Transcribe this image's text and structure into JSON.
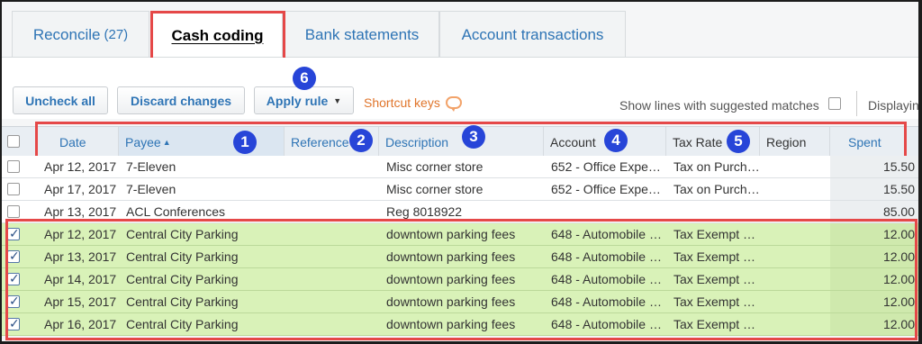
{
  "tabs": [
    {
      "label": "Reconcile",
      "count": "(27)"
    },
    {
      "label": "Cash coding"
    },
    {
      "label": "Bank statements"
    },
    {
      "label": "Account transactions"
    }
  ],
  "toolbar": {
    "uncheck_all": "Uncheck all",
    "discard_changes": "Discard changes",
    "apply_rule": "Apply rule",
    "shortcut_keys": "Shortcut keys",
    "suggested_label": "Show lines with suggested matches",
    "displaying": "Displaying"
  },
  "badges": [
    "1",
    "2",
    "3",
    "4",
    "5",
    "6"
  ],
  "columns": {
    "date": "Date",
    "payee": "Payee",
    "reference": "Reference",
    "description": "Description",
    "account": "Account",
    "tax_rate": "Tax Rate",
    "region": "Region",
    "spent": "Spent"
  },
  "rows": [
    {
      "date": "Apr 12, 2017",
      "payee": "7-Eleven",
      "reference": "",
      "description": "Misc corner store",
      "account": "652 - Office Expe…",
      "tax_rate": "Tax on Purch…",
      "region": "",
      "spent": "15.50"
    },
    {
      "date": "Apr 17, 2017",
      "payee": "7-Eleven",
      "reference": "",
      "description": "Misc corner store",
      "account": "652 - Office Expe…",
      "tax_rate": "Tax on Purch…",
      "region": "",
      "spent": "15.50"
    },
    {
      "date": "Apr 13, 2017",
      "payee": "ACL Conferences",
      "reference": "",
      "description": "Reg 8018922",
      "account": "",
      "tax_rate": "",
      "region": "",
      "spent": "85.00"
    },
    {
      "date": "Apr 12, 2017",
      "payee": "Central City Parking",
      "reference": "",
      "description": "downtown parking fees",
      "account": "648 - Automobile …",
      "tax_rate": "Tax Exempt …",
      "region": "",
      "spent": "12.00"
    },
    {
      "date": "Apr 13, 2017",
      "payee": "Central City Parking",
      "reference": "",
      "description": "downtown parking fees",
      "account": "648 - Automobile …",
      "tax_rate": "Tax Exempt …",
      "region": "",
      "spent": "12.00"
    },
    {
      "date": "Apr 14, 2017",
      "payee": "Central City Parking",
      "reference": "",
      "description": "downtown parking fees",
      "account": "648 - Automobile …",
      "tax_rate": "Tax Exempt …",
      "region": "",
      "spent": "12.00"
    },
    {
      "date": "Apr 15, 2017",
      "payee": "Central City Parking",
      "reference": "",
      "description": "downtown parking fees",
      "account": "648 - Automobile …",
      "tax_rate": "Tax Exempt …",
      "region": "",
      "spent": "12.00"
    },
    {
      "date": "Apr 16, 2017",
      "payee": "Central City Parking",
      "reference": "",
      "description": "downtown parking fees",
      "account": "648 - Automobile …",
      "tax_rate": "Tax Exempt …",
      "region": "",
      "spent": "12.00"
    }
  ],
  "row_selected": [
    false,
    false,
    false,
    true,
    true,
    true,
    true,
    true
  ],
  "colors": {
    "link": "#2e74b5",
    "highlight_border": "#e54848",
    "badge": "#2745d8",
    "selected_row": "#d9f2b8",
    "shortcut": "#e0752b"
  }
}
